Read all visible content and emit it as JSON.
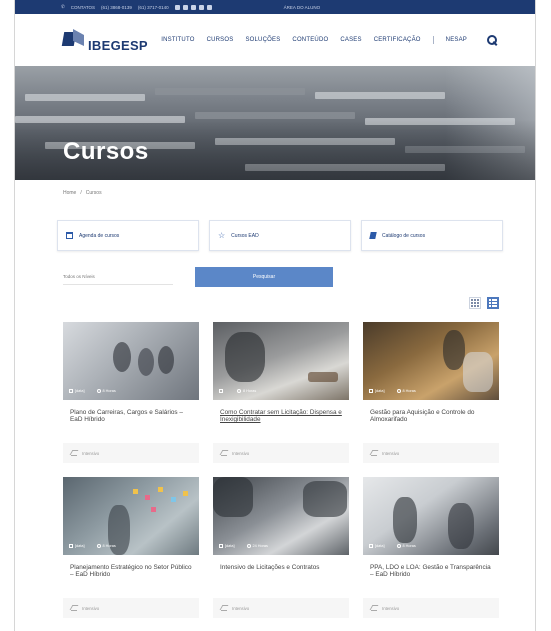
{
  "topbar": {
    "contact": "CONTATOS",
    "phone1": "(61) 3868-0139",
    "phone2": "(61) 3717-0140",
    "student_area": "ÁREA DO ALUNO"
  },
  "brand": {
    "name": "IBEGESP"
  },
  "nav": {
    "items": [
      "INSTITUTO",
      "CURSOS",
      "SOLUÇÕES",
      "CONTEÚDO",
      "CASES",
      "CERTIFICAÇÃO",
      "NESAP"
    ]
  },
  "hero": {
    "title": "Cursos"
  },
  "breadcrumb": {
    "home": "Home",
    "separator": "/",
    "current": "Cursos"
  },
  "quick_links": [
    {
      "label": "Agenda de cursos",
      "icon": "calendar-icon"
    },
    {
      "label": "Cursos EAD",
      "icon": "star-icon"
    },
    {
      "label": "Catálogo de cursos",
      "icon": "book-icon"
    }
  ],
  "filters": {
    "level_placeholder": "Todos os Níveis",
    "search_label": "Pesquisar"
  },
  "courses": [
    {
      "title": "Plano de Carreiras, Cargos e Salários – EaD Híbrido",
      "date": "[data]",
      "hours": "8 Horas",
      "level": "Intensivo"
    },
    {
      "title": "Como Contratar sem Licitação: Dispensa e Inexigibilidade",
      "date": "",
      "hours": "8 Horas",
      "level": "Intensivo"
    },
    {
      "title": "Gestão para Aquisição e Controle do Almoxarifado",
      "date": "[data]",
      "hours": "8 Horas",
      "level": "Intensivo"
    },
    {
      "title": "Planejamento Estratégico no Setor Público – EaD Híbrido",
      "date": "[data]",
      "hours": "8 Horas",
      "level": "Intensivo"
    },
    {
      "title": "Intensivo de Licitações e Contratos",
      "date": "[data]",
      "hours": "24 Horas",
      "level": "Intensivo"
    },
    {
      "title": "PPA, LDO e LOA: Gestão e Transparência – EaD Híbrido",
      "date": "[data]",
      "hours": "8 Horas",
      "level": "Intensivo"
    }
  ]
}
